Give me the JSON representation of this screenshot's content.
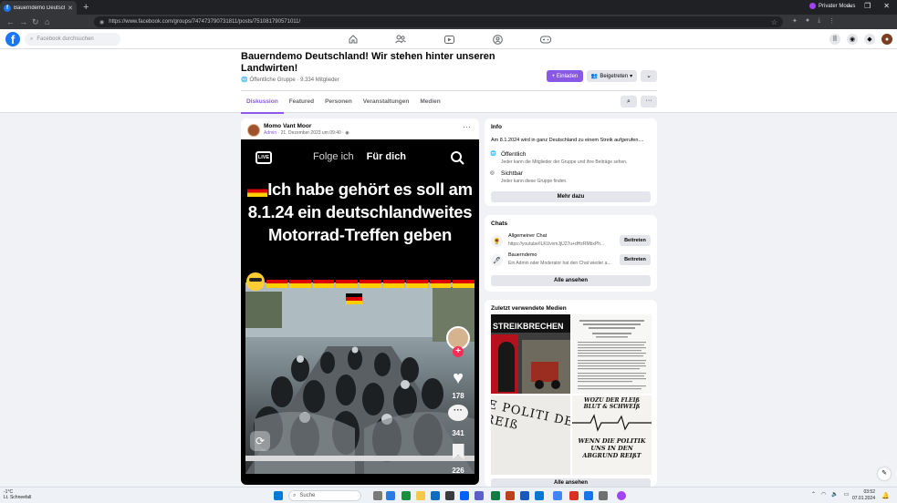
{
  "browser": {
    "tab_title": "Bauerndemo Deutschland! Wi...",
    "new_tab": "+",
    "url": "https://www.facebook.com/groups/747473790731811/posts/751081790571011/",
    "mode_label": "Privater Modus"
  },
  "fb": {
    "logo": "f",
    "search_placeholder": "Facebook durchsuchen"
  },
  "group": {
    "title": "Bauerndemo Deutschland! Wir stehen hinter unseren Landwirten!",
    "subtitle": "Öffentliche Gruppe · 9.334 Mitglieder",
    "invite_label": "+ Einladen",
    "joined_label": "Beigetreten",
    "tabs": [
      {
        "label": "Diskussion"
      },
      {
        "label": "Featured"
      },
      {
        "label": "Personen"
      },
      {
        "label": "Veranstaltungen"
      },
      {
        "label": "Medien"
      }
    ]
  },
  "post": {
    "author": "Momo Vant Moor",
    "admin": "Admin",
    "meta": " · 21. Dezember 2023 um 09:40 · ",
    "video": {
      "live": "LIVE",
      "tab_following": "Folge ich",
      "tab_foryou": "Für dich",
      "headline": "Ich habe  gehört es soll am 8.1.24 ein deutschlandweites Motorrad-Treffen geben",
      "likes": "178",
      "comments": "341",
      "saves": "226"
    }
  },
  "info": {
    "title": "Info",
    "description": "Am 8.1.2024 wird in ganz Deutschland zu einem Streik aufgerufen....",
    "public_title": "Öffentlich",
    "public_desc": "Jeder kann die Mitglieder der Gruppe und ihre Beiträge sehen.",
    "visible_title": "Sichtbar",
    "visible_desc": "Jeder kann diese Gruppe finden.",
    "more_button": "Mehr dazu"
  },
  "chats": {
    "title": "Chats",
    "items": [
      {
        "name": "Allgemeiner Chat",
        "desc": "https://youtube/ILKUvvmJjU27u+dHzRMbxPh...",
        "button": "Beitreten"
      },
      {
        "name": "Bauerndemo",
        "desc": "Ein Admin oder Moderator hat den Chat wieder a...",
        "button": "Beitreten"
      }
    ],
    "see_all": "Alle ansehen"
  },
  "media": {
    "title": "Zuletzt verwendete Medien",
    "tile1_text": "STREIKBRECHEN",
    "tile3_text": "E POLITI DEN REIß",
    "tile4_text_top": "WOZU DER FLEIß BLUT & SCHWEIß",
    "tile4_text_bottom": "WENN DIE POLITIK UNS IN DEN ABGRUND REIßT",
    "see_all": "Alle ansehen"
  },
  "taskbar": {
    "weather_temp": "-1°C",
    "weather_desc": "Lt. Schneefall",
    "search": "Suche",
    "time": "03:52",
    "date": "07.01.2024"
  },
  "colors": {
    "accent": "#8a58e6",
    "facebook_blue": "#1877f2",
    "like_red": "#fe2c55"
  }
}
